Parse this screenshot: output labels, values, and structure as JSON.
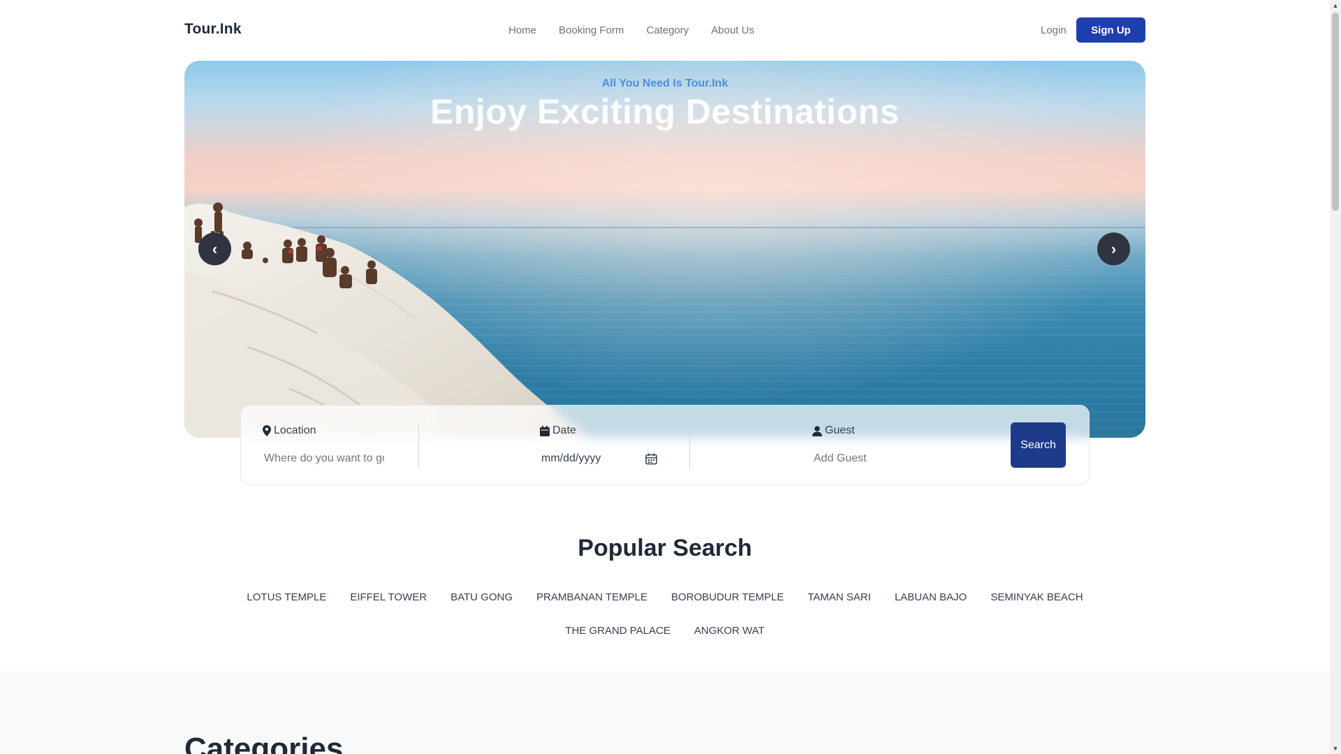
{
  "brand": "Tour.Ink",
  "nav": {
    "links": [
      "Home",
      "Booking Form",
      "Category",
      "About Us"
    ],
    "login": "Login",
    "signup": "Sign Up"
  },
  "hero": {
    "tagline": "All You Need Is Tour.Ink",
    "title": "Enjoy Exciting Destinations",
    "prev_glyph": "‹",
    "next_glyph": "›"
  },
  "search": {
    "location_label": "Location",
    "location_placeholder": "Where do you want to go",
    "date_label": "Date",
    "date_value": "mm/dd/yyyy",
    "guest_label": "Guest",
    "guest_placeholder": "Add Guest",
    "button": "Search"
  },
  "popular": {
    "title": "Popular Search",
    "tags": [
      "LOTUS TEMPLE",
      "EIFFEL TOWER",
      "BATU GONG",
      "PRAMBANAN TEMPLE",
      "BOROBUDUR TEMPLE",
      "TAMAN SARI",
      "LABUAN BAJO",
      "SEMINYAK BEACH",
      "THE GRAND PALACE",
      "ANGKOR WAT"
    ]
  },
  "categories": {
    "title": "Categories"
  },
  "colors": {
    "primary": "#1e40af",
    "search_button": "#1e3a8a",
    "tagline": "#4a90d9"
  },
  "icons": [
    "map-pin-icon",
    "calendar-icon",
    "user-icon",
    "calendar-picker-icon",
    "chevron-left-icon",
    "chevron-right-icon"
  ]
}
